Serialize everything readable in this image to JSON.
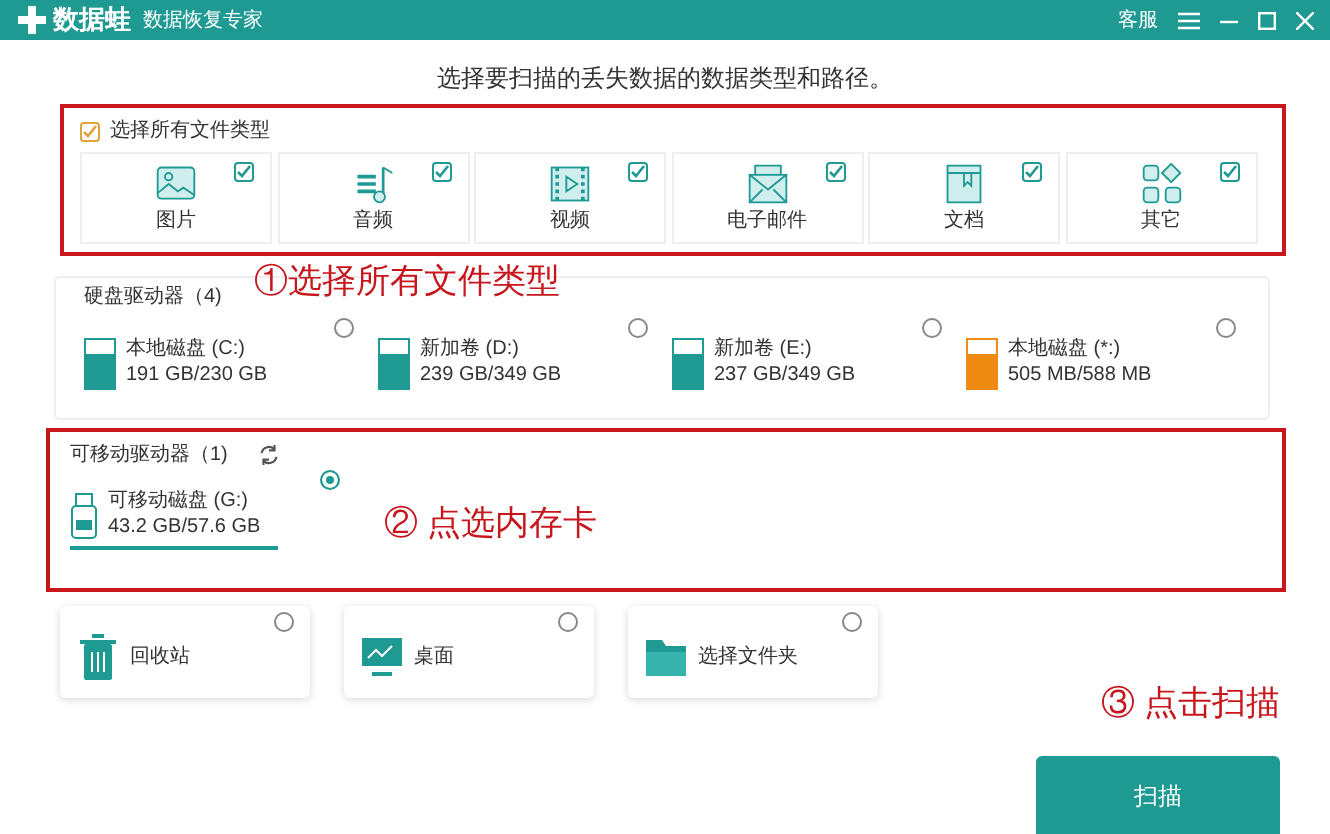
{
  "app": {
    "logo": "数据蛙",
    "subtitle": "数据恢复专家",
    "service": "客服"
  },
  "heading": "选择要扫描的丢失数据的数据类型和路径。",
  "file_types": {
    "select_all": {
      "label": "选择所有文件类型",
      "checked": true
    },
    "items": [
      {
        "label": "图片",
        "checked": true
      },
      {
        "label": "音频",
        "checked": true
      },
      {
        "label": "视频",
        "checked": true
      },
      {
        "label": "电子邮件",
        "checked": true
      },
      {
        "label": "文档",
        "checked": true
      },
      {
        "label": "其它",
        "checked": true
      }
    ]
  },
  "hard_drives": {
    "title": "硬盘驱动器（4)",
    "drives": [
      {
        "name": "本地磁盘 (C:)",
        "usage": "191 GB/230 GB",
        "selected": false,
        "color": "#1f9a93"
      },
      {
        "name": "新加卷 (D:)",
        "usage": "239 GB/349 GB",
        "selected": false,
        "color": "#1f9a93"
      },
      {
        "name": "新加卷 (E:)",
        "usage": "237 GB/349 GB",
        "selected": false,
        "color": "#1f9a93"
      },
      {
        "name": "本地磁盘 (*:)",
        "usage": "505 MB/588 MB",
        "selected": false,
        "color": "#ef8a12"
      }
    ]
  },
  "removable": {
    "title": "可移动驱动器（1)",
    "drives": [
      {
        "name": "可移动磁盘 (G:)",
        "usage": "43.2 GB/57.6 GB",
        "selected": true
      }
    ]
  },
  "locations": [
    {
      "label": "回收站",
      "selected": false
    },
    {
      "label": "桌面",
      "selected": false
    },
    {
      "label": "选择文件夹",
      "selected": false
    }
  ],
  "scan_button": "扫描",
  "annotations": [
    "①选择所有文件类型",
    "② 点选内存卡",
    "③ 点击扫描"
  ]
}
